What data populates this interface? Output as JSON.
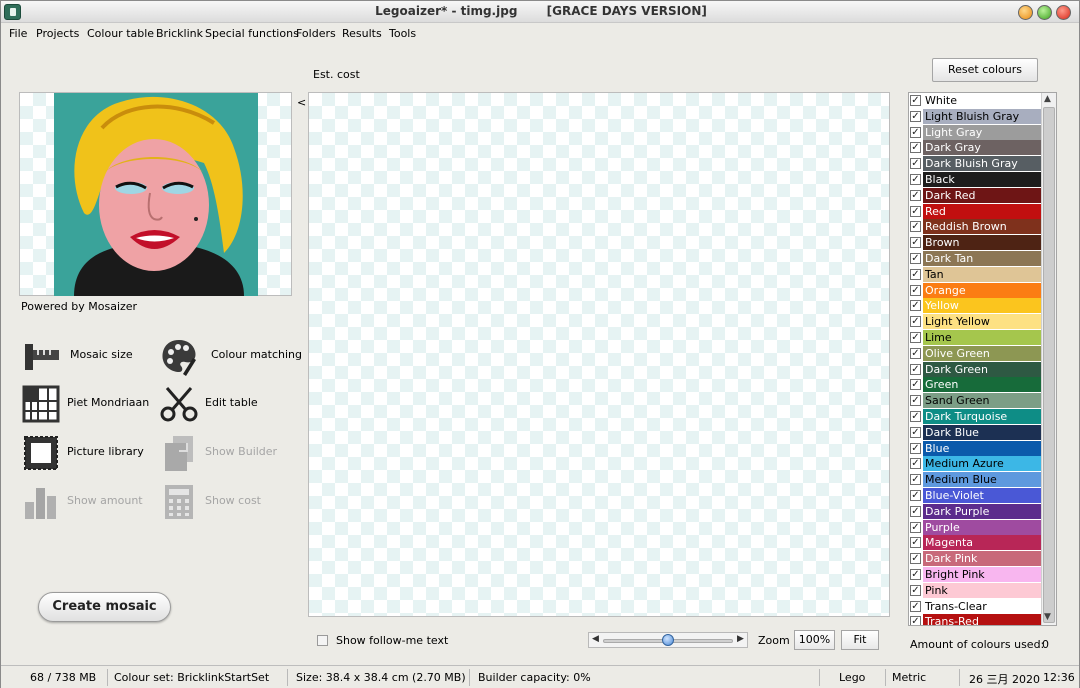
{
  "window": {
    "title": "Legoaizer* - timg.jpg       [GRACE DAYS VERSION]"
  },
  "menu": [
    "File",
    "Projects",
    "Colour table",
    "Bricklink",
    "Special functions",
    "Folders",
    "Results",
    "Tools"
  ],
  "preview": {
    "powered_by": "Powered by Mosaizer"
  },
  "tools": [
    {
      "label": "Mosaic size",
      "icon": "ruler-icon",
      "enabled": true
    },
    {
      "label": "Colour matching",
      "icon": "palette-icon",
      "enabled": true
    },
    {
      "label": "Piet Mondriaan",
      "icon": "grid-icon",
      "enabled": true
    },
    {
      "label": "Edit table",
      "icon": "scissors-icon",
      "enabled": true
    },
    {
      "label": "Picture library",
      "icon": "picture-frame-icon",
      "enabled": true
    },
    {
      "label": "Show Builder",
      "icon": "documents-icon",
      "enabled": false
    },
    {
      "label": "Show amount",
      "icon": "bar-chart-icon",
      "enabled": false
    },
    {
      "label": "Show cost",
      "icon": "calculator-icon",
      "enabled": false
    }
  ],
  "create_button": "Create mosaic",
  "canvas": {
    "est_cost_label": "Est. cost",
    "collapse_arrow": "<"
  },
  "bottom_controls": {
    "follow_me_label": "Show follow-me text",
    "follow_me_checked": false,
    "zoom_label": "Zoom",
    "zoom_value": "100%",
    "fit_label": "Fit",
    "zoom_slider_fraction": 0.5
  },
  "colour_panel": {
    "reset_label": "Reset colours",
    "amount_label": "Amount of colours used:",
    "amount_value": "0",
    "colours": [
      {
        "name": "White",
        "hex": "#ffffff",
        "text": "#000000",
        "checked": true
      },
      {
        "name": "Light Bluish Gray",
        "hex": "#a8aebf",
        "text": "#000000",
        "checked": true
      },
      {
        "name": "Light Gray",
        "hex": "#9c9c9c",
        "text": "#ffffff",
        "checked": true
      },
      {
        "name": "Dark Gray",
        "hex": "#6d6262",
        "text": "#ffffff",
        "checked": true
      },
      {
        "name": "Dark Bluish Gray",
        "hex": "#575e63",
        "text": "#ffffff",
        "checked": true
      },
      {
        "name": "Black",
        "hex": "#1d1d1d",
        "text": "#ffffff",
        "checked": true
      },
      {
        "name": "Dark Red",
        "hex": "#6e1515",
        "text": "#ffffff",
        "checked": true
      },
      {
        "name": "Red",
        "hex": "#c10f0f",
        "text": "#ffffff",
        "checked": true
      },
      {
        "name": "Reddish Brown",
        "hex": "#7f311c",
        "text": "#ffffff",
        "checked": true
      },
      {
        "name": "Brown",
        "hex": "#4e2314",
        "text": "#ffffff",
        "checked": true
      },
      {
        "name": "Dark Tan",
        "hex": "#8c7654",
        "text": "#ffffff",
        "checked": true
      },
      {
        "name": "Tan",
        "hex": "#dfc596",
        "text": "#000000",
        "checked": true
      },
      {
        "name": "Orange",
        "hex": "#fb7d13",
        "text": "#ffffff",
        "checked": true
      },
      {
        "name": "Yellow",
        "hex": "#fbc51e",
        "text": "#ffffff",
        "checked": true
      },
      {
        "name": "Light Yellow",
        "hex": "#fde183",
        "text": "#000000",
        "checked": true
      },
      {
        "name": "Lime",
        "hex": "#a5c64d",
        "text": "#000000",
        "checked": true
      },
      {
        "name": "Olive Green",
        "hex": "#8d9753",
        "text": "#ffffff",
        "checked": true
      },
      {
        "name": "Dark Green",
        "hex": "#2e5943",
        "text": "#ffffff",
        "checked": true
      },
      {
        "name": "Green",
        "hex": "#176b3a",
        "text": "#ffffff",
        "checked": true
      },
      {
        "name": "Sand Green",
        "hex": "#7c9e86",
        "text": "#000000",
        "checked": true
      },
      {
        "name": "Dark Turquoise",
        "hex": "#0e8d86",
        "text": "#ffffff",
        "checked": true
      },
      {
        "name": "Dark Blue",
        "hex": "#1c3053",
        "text": "#ffffff",
        "checked": true
      },
      {
        "name": "Blue",
        "hex": "#0b5aab",
        "text": "#ffffff",
        "checked": true
      },
      {
        "name": "Medium Azure",
        "hex": "#3cb7e6",
        "text": "#000000",
        "checked": true
      },
      {
        "name": "Medium Blue",
        "hex": "#5e99de",
        "text": "#000000",
        "checked": true
      },
      {
        "name": "Blue-Violet",
        "hex": "#4a58d6",
        "text": "#ffffff",
        "checked": true
      },
      {
        "name": "Dark Purple",
        "hex": "#5c2c8c",
        "text": "#ffffff",
        "checked": true
      },
      {
        "name": "Purple",
        "hex": "#9f4ba0",
        "text": "#ffffff",
        "checked": true
      },
      {
        "name": "Magenta",
        "hex": "#b82657",
        "text": "#ffffff",
        "checked": true
      },
      {
        "name": "Dark Pink",
        "hex": "#c8697a",
        "text": "#ffffff",
        "checked": true
      },
      {
        "name": "Bright Pink",
        "hex": "#f8b6ef",
        "text": "#000000",
        "checked": true
      },
      {
        "name": "Pink",
        "hex": "#fdc9d4",
        "text": "#000000",
        "checked": true
      },
      {
        "name": "Trans-Clear",
        "hex": "#ffffff",
        "text": "#000000",
        "checked": true
      },
      {
        "name": "Trans-Red",
        "hex": "#b51010",
        "text": "#ffffff",
        "checked": true
      }
    ]
  },
  "status": {
    "memory": "68 / 738 MB",
    "colour_set": "Colour set: BricklinkStartSet",
    "size": "Size: 38.4 x 38.4 cm (2.70 MB)",
    "builder": "Builder capacity: 0%",
    "brand": "Lego",
    "units": "Metric",
    "date": "26 三月 2020",
    "time": "12:36"
  }
}
